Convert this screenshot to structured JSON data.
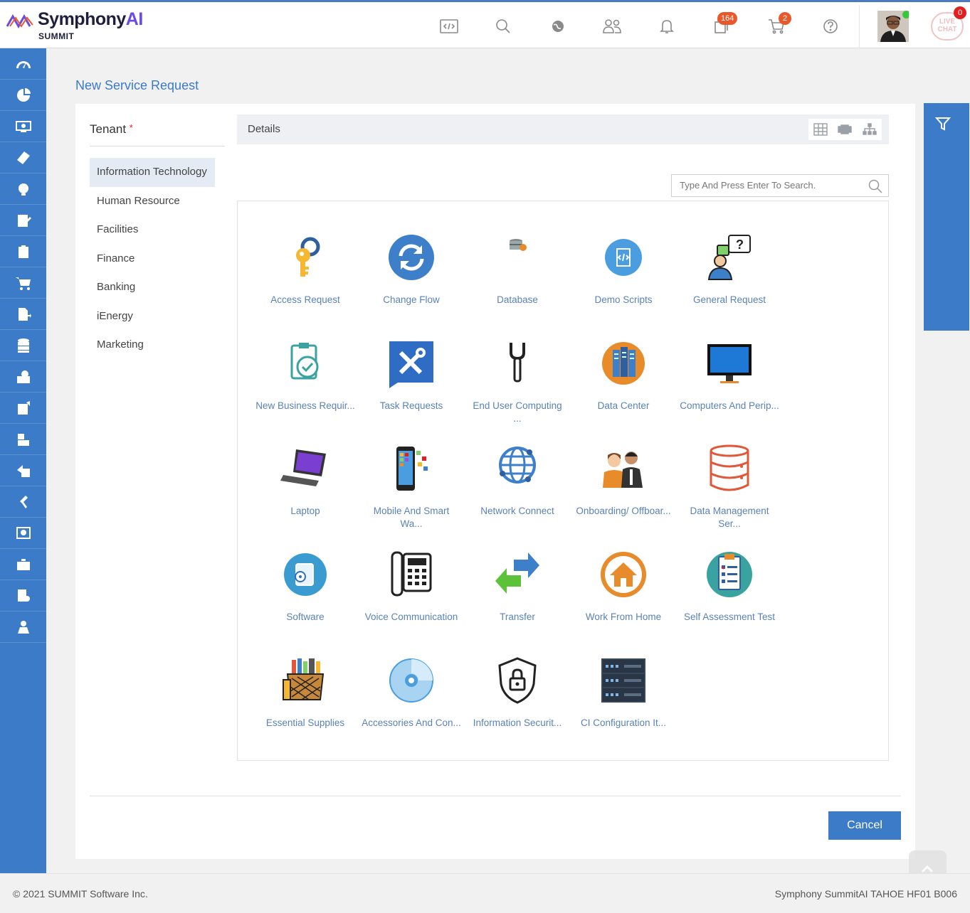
{
  "header": {
    "logo_brand": "Symphony",
    "logo_brand_ai": "AI",
    "logo_sub": "SUMMIT",
    "task_count": "164",
    "cart_count": "2",
    "chat_count": "0",
    "chat_label": "LIVE CHAT"
  },
  "page": {
    "title": "New Service Request"
  },
  "tenant": {
    "heading": "Tenant",
    "required_mark": "*",
    "items": [
      "Information Technology",
      "Human Resource",
      "Facilities",
      "Finance",
      "Banking",
      "iEnergy",
      "Marketing"
    ],
    "selected": "Information Technology"
  },
  "details": {
    "label": "Details"
  },
  "search": {
    "placeholder": "Type And Press Enter To Search."
  },
  "catalog": {
    "items": [
      {
        "label": "Access Request",
        "icon": "key-icon"
      },
      {
        "label": "Change Flow",
        "icon": "refresh-icon"
      },
      {
        "label": "Database",
        "icon": "database-small-icon"
      },
      {
        "label": "Demo Scripts",
        "icon": "script-icon"
      },
      {
        "label": "General Request",
        "icon": "question-person-icon"
      },
      {
        "label": "New Business Requir...",
        "icon": "clipboard-check-icon"
      },
      {
        "label": "Task Requests",
        "icon": "tools-icon"
      },
      {
        "label": "End User Computing ...",
        "icon": "wrench-icon"
      },
      {
        "label": "Data Center",
        "icon": "server-rack-icon"
      },
      {
        "label": "Computers And Perip...",
        "icon": "monitor-icon"
      },
      {
        "label": "Laptop",
        "icon": "laptop-icon"
      },
      {
        "label": "Mobile And Smart Wa...",
        "icon": "smartphone-icon"
      },
      {
        "label": "Network Connect",
        "icon": "globe-network-icon"
      },
      {
        "label": "Onboarding/ Offboar...",
        "icon": "people-icon"
      },
      {
        "label": "Data Management Ser...",
        "icon": "database-icon"
      },
      {
        "label": "Software",
        "icon": "software-disc-icon"
      },
      {
        "label": "Voice Communication",
        "icon": "desk-phone-icon"
      },
      {
        "label": "Transfer",
        "icon": "transfer-arrows-icon"
      },
      {
        "label": "Work From Home",
        "icon": "home-icon"
      },
      {
        "label": "Self Assessment Test",
        "icon": "checklist-icon"
      },
      {
        "label": "Essential Supplies",
        "icon": "basket-icon"
      },
      {
        "label": "Accessories And Con...",
        "icon": "cd-icon"
      },
      {
        "label": "Information Securit...",
        "icon": "shield-lock-icon"
      },
      {
        "label": "CI Configuration It...",
        "icon": "server-stack-icon"
      }
    ]
  },
  "buttons": {
    "cancel": "Cancel"
  },
  "footer": {
    "copyright": "© 2021 SUMMIT Software Inc.",
    "version": "Symphony SummitAI TAHOE HF01 B006"
  },
  "colors": {
    "accent": "#3b7bc8",
    "link": "#5a82b8",
    "badge": "#e8582a"
  }
}
